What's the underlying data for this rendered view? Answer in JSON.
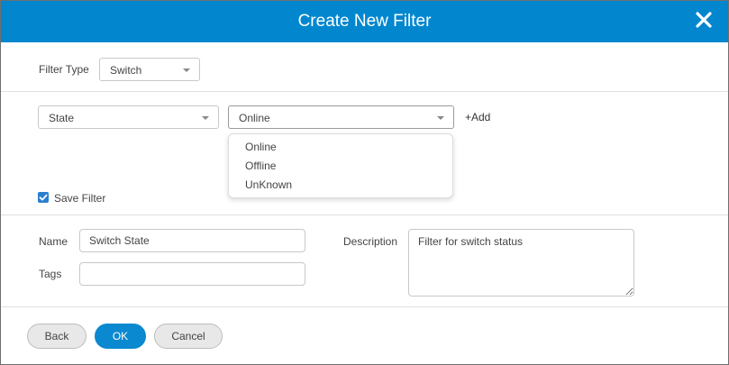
{
  "dialog": {
    "title": "Create New Filter"
  },
  "filter_type": {
    "label": "Filter Type",
    "value": "Switch"
  },
  "condition": {
    "field_value": "State",
    "operator_value": "Online",
    "add_label": "+Add",
    "dropdown_options": [
      "Online",
      "Offline",
      "UnKnown"
    ]
  },
  "save_filter": {
    "label": "Save Filter",
    "checked": true
  },
  "form": {
    "name_label": "Name",
    "name_value": "Switch State",
    "tags_label": "Tags",
    "tags_value": "",
    "description_label": "Description",
    "description_value": "Filter for switch status"
  },
  "footer": {
    "back_label": "Back",
    "ok_label": "OK",
    "cancel_label": "Cancel"
  },
  "colors": {
    "header": "#0287cf",
    "primary_button": "#0a88d0",
    "checkbox": "#2b7fd0"
  }
}
